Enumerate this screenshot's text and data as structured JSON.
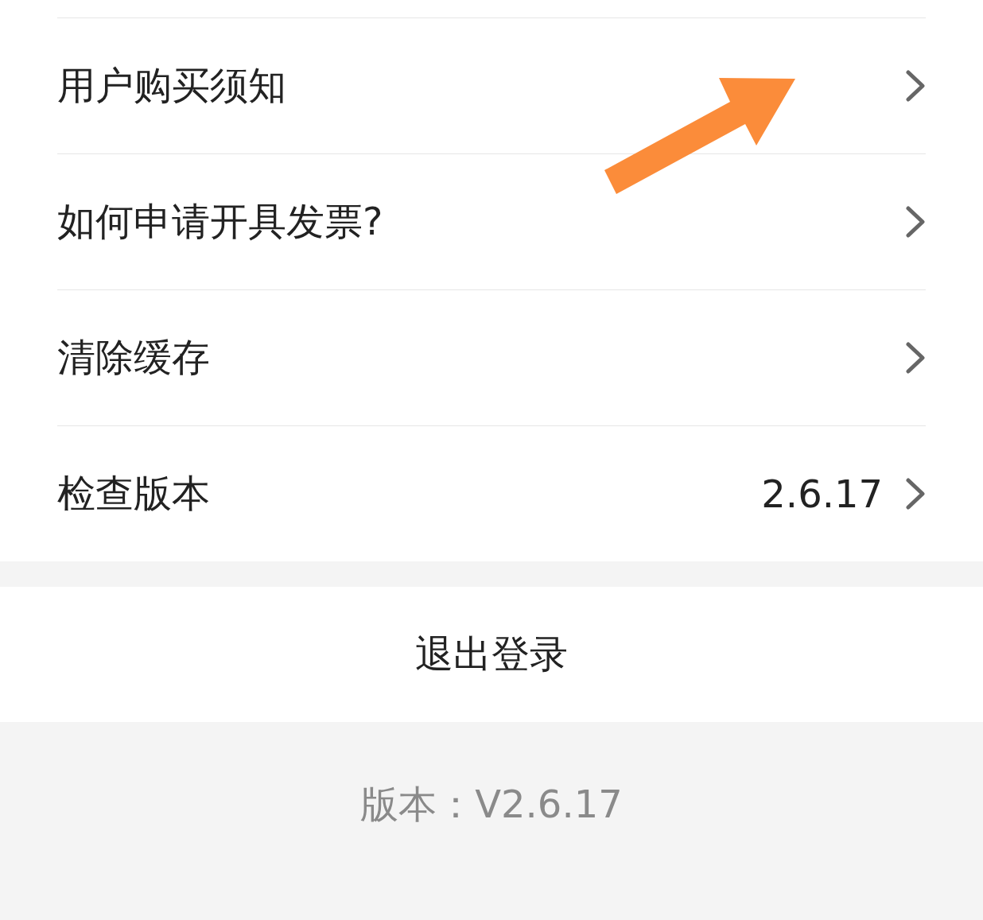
{
  "settings_list": [
    {
      "label": "用户购买须知",
      "chevron": true
    },
    {
      "label": "如何申请开具发票?",
      "chevron": true
    },
    {
      "label": "清除缓存",
      "chevron": true
    },
    {
      "label": "检查版本",
      "value": "2.6.17",
      "chevron": true
    }
  ],
  "logout_button": {
    "label": "退出登录"
  },
  "footer": {
    "version_text": "版本：V2.6.17"
  },
  "annotations": [
    {
      "kind": "arrow"
    }
  ]
}
